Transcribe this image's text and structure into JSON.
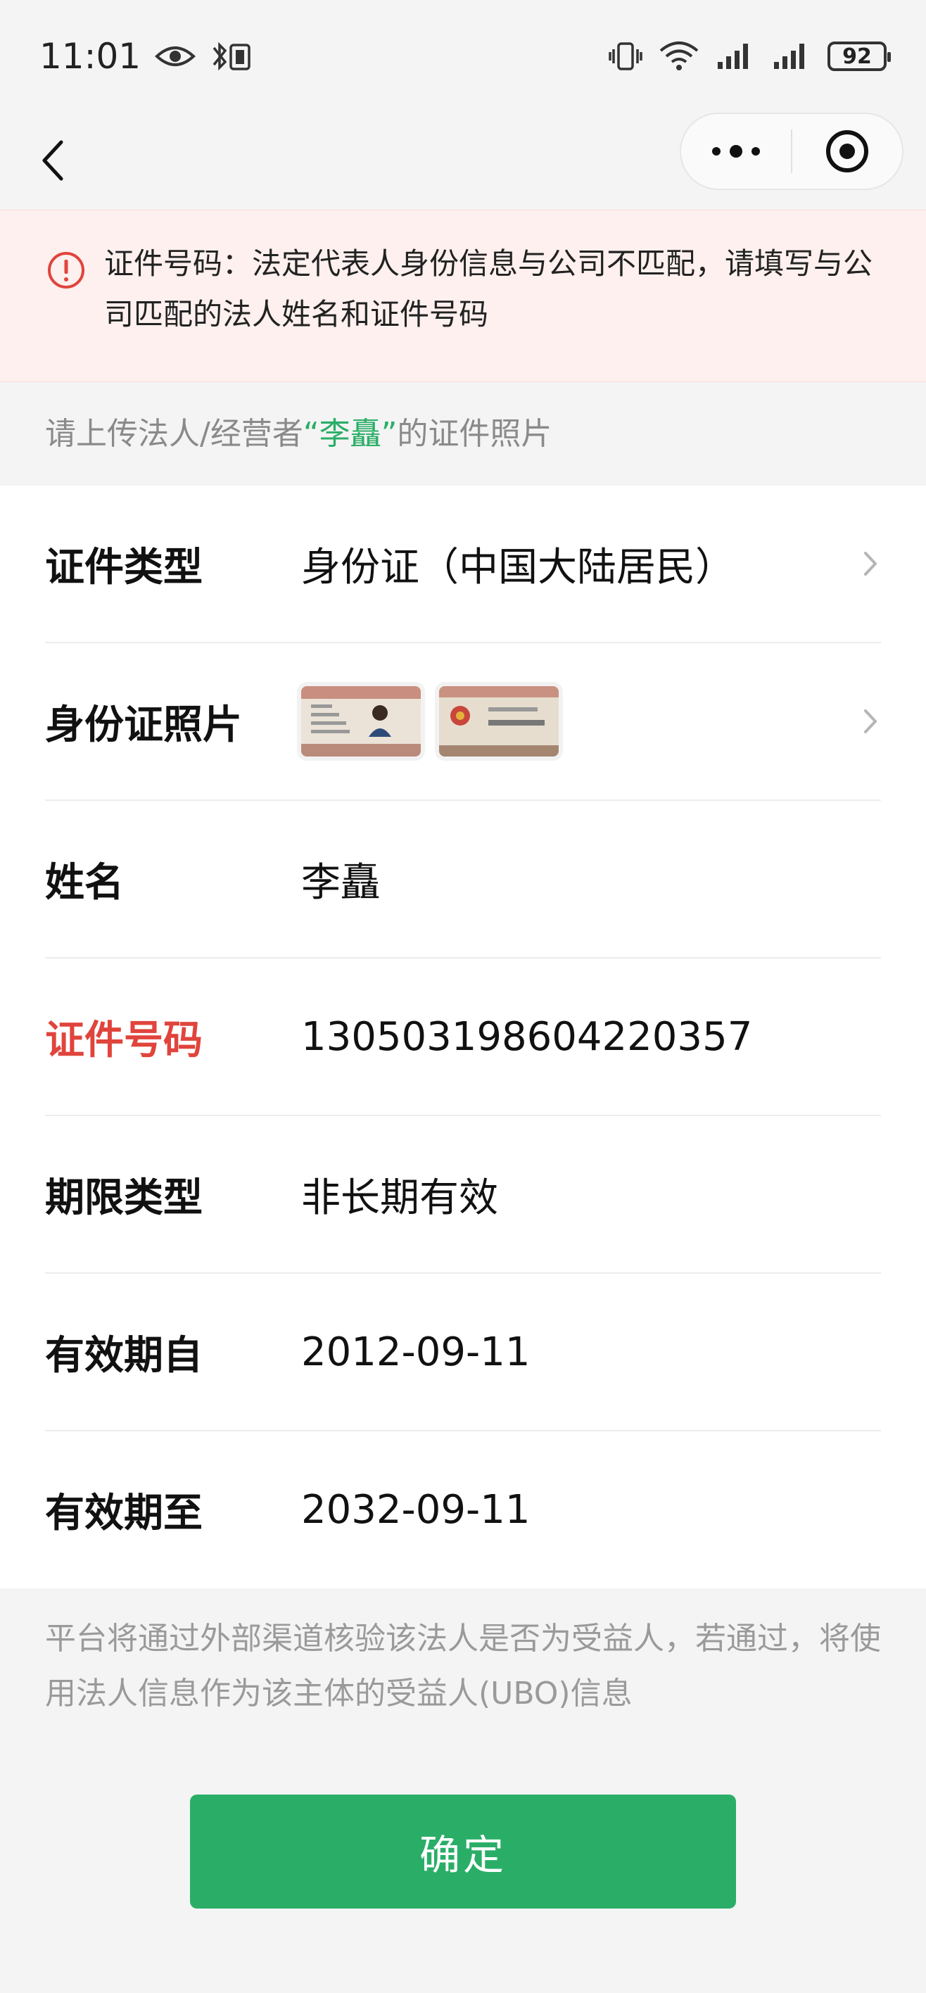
{
  "status_bar": {
    "time": "11:01",
    "battery": "92"
  },
  "alert": {
    "message": "证件号码：法定代表人身份信息与公司不匹配，请填写与公司匹配的法人姓名和证件号码"
  },
  "upload_hint": {
    "prefix": "请上传法人/经营者",
    "name": "“李矗”",
    "suffix": "的证件照片"
  },
  "form": {
    "doc_type": {
      "label": "证件类型",
      "value": "身份证（中国大陆居民）"
    },
    "id_photos": {
      "label": "身份证照片"
    },
    "name": {
      "label": "姓名",
      "value": "李矗"
    },
    "id_number": {
      "label": "证件号码",
      "value": "130503198604220357"
    },
    "validity_type": {
      "label": "期限类型",
      "value": "非长期有效"
    },
    "valid_from": {
      "label": "有效期自",
      "value": "2012-09-11"
    },
    "valid_to": {
      "label": "有效期至",
      "value": "2032-09-11"
    }
  },
  "notice": "平台将通过外部渠道核验该法人是否为受益人，若通过，将使用法人信息作为该主体的受益人(UBO)信息",
  "confirm_label": "确定",
  "colors": {
    "accent": "#2aae67",
    "error": "#e0443c",
    "alert_bg": "#fdf0ee"
  }
}
